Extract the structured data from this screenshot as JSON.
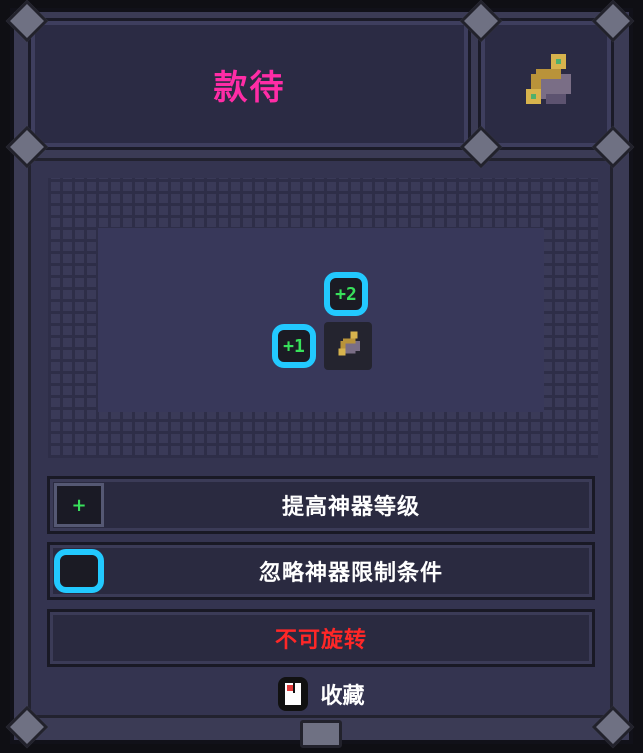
{
  "title": "款待",
  "preview": {
    "badge_plus2": "+2",
    "badge_plus1": "+1"
  },
  "options": [
    {
      "label": "提高神器等级",
      "icon": "plus-icon"
    },
    {
      "label": "忽略神器限制条件",
      "icon": "ring-icon"
    }
  ],
  "warning": "不可旋转",
  "favorite": {
    "label": "收藏",
    "icon": "mouse-icon"
  },
  "colors": {
    "title": "#ff2ca6",
    "badge_border": "#22c9ff",
    "badge_text": "#38e05b",
    "warning": "#ff2727"
  }
}
